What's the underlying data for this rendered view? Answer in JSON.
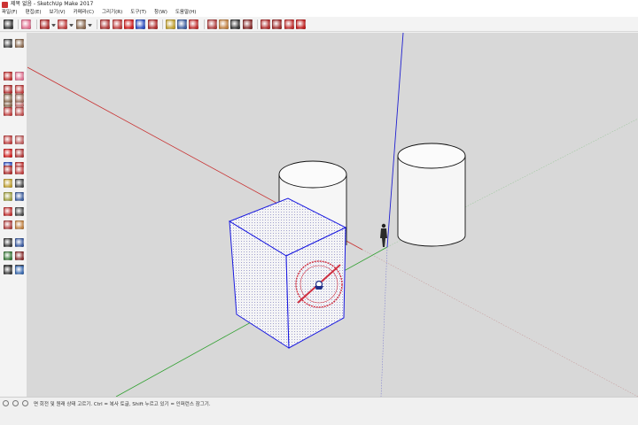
{
  "window": {
    "title": "제목 없음 - SketchUp Make 2017"
  },
  "menu": [
    "파일(F)",
    "편집(E)",
    "보기(V)",
    "카메라(C)",
    "그리기(R)",
    "도구(T)",
    "창(W)",
    "도움말(H)"
  ],
  "toolbar": {
    "icons": [
      {
        "name": "select-icon",
        "color": "#3a3a3a"
      },
      {
        "name": "eraser-icon",
        "color": "#e07090"
      },
      {
        "name": "pencil-icon",
        "color": "#b03030"
      },
      {
        "name": "dropdown-arrow-icon",
        "color": "#555555"
      },
      {
        "name": "arc-icon",
        "color": "#c04040"
      },
      {
        "name": "dropdown-arrow-icon",
        "color": "#555555"
      },
      {
        "name": "rectangle-icon",
        "color": "#8a6a50"
      },
      {
        "name": "dropdown-arrow-icon",
        "color": "#555555"
      },
      {
        "name": "push-pull-icon",
        "color": "#b03a3a"
      },
      {
        "name": "offset-icon",
        "color": "#c04040"
      },
      {
        "name": "move-icon",
        "color": "#d02020"
      },
      {
        "name": "rotate-icon",
        "color": "#3050c0"
      },
      {
        "name": "scale-icon",
        "color": "#b03030"
      },
      {
        "name": "tape-measure-icon",
        "color": "#c0a030"
      },
      {
        "name": "text-icon",
        "color": "#4060a0"
      },
      {
        "name": "paint-bucket-icon",
        "color": "#c03030"
      },
      {
        "name": "orbit-icon",
        "color": "#b04040"
      },
      {
        "name": "pan-icon",
        "color": "#c08040"
      },
      {
        "name": "zoom-icon",
        "color": "#3a3a3a"
      },
      {
        "name": "zoom-extents-icon",
        "color": "#8a3030"
      },
      {
        "name": "3d-warehouse-icon",
        "color": "#b03030"
      },
      {
        "name": "extension-warehouse-icon",
        "color": "#a03030"
      },
      {
        "name": "share-model-icon",
        "color": "#c03030"
      },
      {
        "name": "ruby-icon",
        "color": "#c02020"
      }
    ]
  },
  "statusbar": {
    "hint": "면 회전 및 원래 상태 고르기. Ctrl = 복사 토글, Shift 누르고 있기 = 인퍼런스 잠그기."
  },
  "colors": {
    "viewport_bg": "#d8d8d8",
    "red_axis": "#c83030",
    "green_axis": "#30a030",
    "blue_axis": "#2020d0",
    "selection": "#1a1ae0",
    "face_light": "#f6f6f6",
    "protractor": "#d03040"
  },
  "scene": {
    "objects": [
      "box",
      "cylinder-left",
      "cylinder-right",
      "person-figure",
      "protractor-cursor"
    ]
  }
}
